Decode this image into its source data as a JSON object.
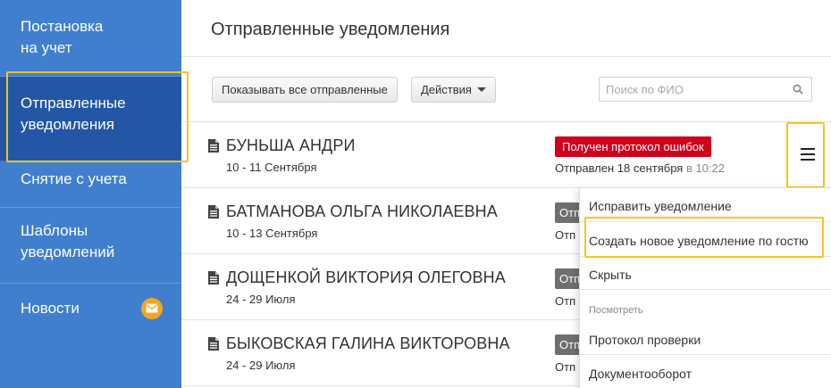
{
  "sidebar": {
    "items": [
      {
        "label": "Постановка\nна учет"
      },
      {
        "label": "Отправленные\nуведомления"
      },
      {
        "label": "Снятие с учета"
      },
      {
        "label": "Шаблоны\nуведомлений"
      },
      {
        "label": "Новости"
      }
    ],
    "active_index": 1,
    "news_icon": "envelope-icon",
    "colors": {
      "background": "#3f7fce",
      "active": "#2357a6",
      "badge": "#f5a623"
    }
  },
  "header": {
    "title": "Отправленные уведомления"
  },
  "toolbar": {
    "filter_label": "Показывать все отправленные",
    "actions_label": "Действия",
    "search_placeholder": "Поиск по ФИО",
    "search_value": ""
  },
  "rows": [
    {
      "name": "БУНЬША АНДРИ",
      "dates": "10 - 11 Сентября",
      "status": "Получен протокол ошибок",
      "status_color": "#d0021b",
      "sent": "Отправлен 18 сентября",
      "sent_time": "в 10:22"
    },
    {
      "name": "БАТМАНОВА ОЛЬГА НИКОЛАЕВНА",
      "dates": "10 - 13 Сентября",
      "status_clip": "Отп",
      "sent_clip": "Отп"
    },
    {
      "name": "ДОЩЕНКОЙ ВИКТОРИЯ ОЛЕГОВНА",
      "dates": "24 - 29 Июля",
      "status_clip": "Отп",
      "sent_clip": "Отп"
    },
    {
      "name": "БЫКОВСКАЯ ГАЛИНА ВИКТОРОВНА",
      "dates": "24 - 29 Июля",
      "status_clip": "Отп",
      "sent_clip": "Отп"
    }
  ],
  "row_menu": {
    "items": [
      "Исправить уведомление",
      "Создать новое уведомление по гостю",
      "Скрыть"
    ],
    "section_heading": "Посмотреть",
    "section_items": [
      "Протокол проверки",
      "Документооборот"
    ]
  },
  "highlight_color": "#f7c518"
}
